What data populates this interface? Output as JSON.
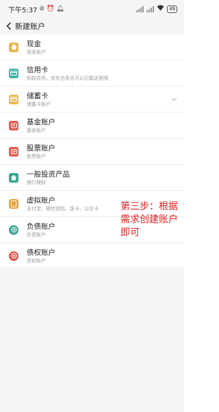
{
  "status_bar": {
    "time": "下午5:37",
    "battery": "49"
  },
  "header": {
    "title": "新建账户"
  },
  "accounts": [
    {
      "title": "现金",
      "subtitle": "现金账户",
      "icon": "cash-icon",
      "color": "#e6b84a"
    },
    {
      "title": "信用卡",
      "subtitle": "蚂蚁花呗、京东白条也可以记载这里哦",
      "icon": "credit-card-icon",
      "color": "#3bb6a6"
    },
    {
      "title": "储蓄卡",
      "subtitle": "储蓄卡账户",
      "icon": "debit-card-icon",
      "color": "#e8b94e"
    },
    {
      "title": "基金账户",
      "subtitle": "基金账户",
      "icon": "fund-icon",
      "color": "#e05a4f"
    },
    {
      "title": "股票账户",
      "subtitle": "股票账户",
      "icon": "stock-icon",
      "color": "#e05a4f"
    },
    {
      "title": "一般投资产品",
      "subtitle": "银行理财",
      "icon": "investment-icon",
      "color": "#3aa593"
    },
    {
      "title": "虚拟账户",
      "subtitle": "支付宝、微信钱包、饭卡、公交卡",
      "icon": "virtual-wallet-icon",
      "color": "#e8a33d"
    },
    {
      "title": "负债账户",
      "subtitle": "负债账户",
      "icon": "liability-icon",
      "color": "#3aa593"
    },
    {
      "title": "债权账户",
      "subtitle": "债权账户",
      "icon": "credit-rights-icon",
      "color": "#e05a4f"
    }
  ],
  "annotation": "第三步：根据需求创建账户即可"
}
